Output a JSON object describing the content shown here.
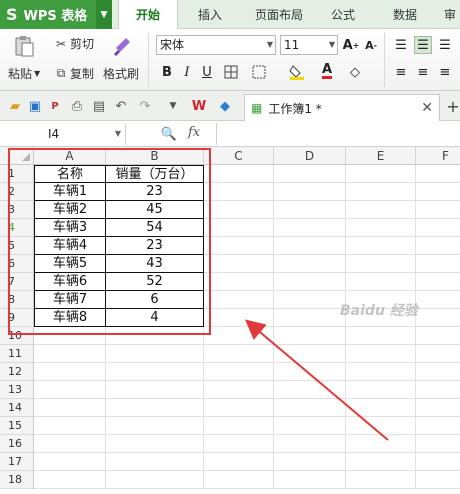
{
  "app": {
    "title": "WPS 表格"
  },
  "ribbon_tabs": [
    "开始",
    "插入",
    "页面布局",
    "公式",
    "数据"
  ],
  "clipboard": {
    "paste": "粘贴",
    "cut": "剪切",
    "copy": "复制",
    "format_painter": "格式刷"
  },
  "font": {
    "name": "宋体",
    "size": "11"
  },
  "document": {
    "tab_title": "工作簿1 *"
  },
  "formula_bar": {
    "name_box": "I4",
    "fx": "fx",
    "value": ""
  },
  "columns": [
    "A",
    "B",
    "C",
    "D",
    "E",
    "F"
  ],
  "rows": [
    "1",
    "2",
    "3",
    "4",
    "5",
    "6",
    "7",
    "8",
    "9",
    "10",
    "11",
    "12",
    "13",
    "14",
    "15",
    "16",
    "17",
    "18"
  ],
  "table": {
    "headers": [
      "名称",
      "销量（万台）"
    ],
    "rows": [
      [
        "车辆1",
        "23"
      ],
      [
        "车辆2",
        "45"
      ],
      [
        "车辆3",
        "54"
      ],
      [
        "车辆4",
        "23"
      ],
      [
        "车辆5",
        "43"
      ],
      [
        "车辆6",
        "52"
      ],
      [
        "车辆7",
        "6"
      ],
      [
        "车辆8",
        "4"
      ]
    ]
  },
  "annotation": {
    "highlight_color": "#e23a3a"
  },
  "watermark": {
    "text": "Baidu 经验"
  },
  "colors": {
    "brand_green": "#3f9d3f",
    "active_tab_text": "#1b7a1b"
  }
}
